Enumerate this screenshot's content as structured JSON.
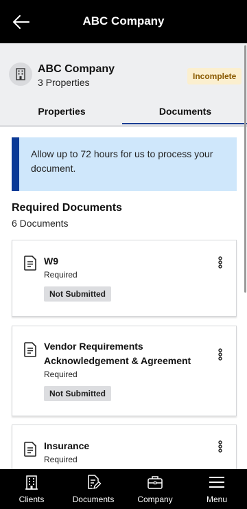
{
  "topbar": {
    "title": "ABC Company",
    "back_icon": "arrow-left-icon"
  },
  "company": {
    "name": "ABC Company",
    "properties_count": "3 Properties",
    "status_badge": "Incomplete",
    "avatar_icon": "building-icon"
  },
  "tabs": [
    {
      "label": "Properties",
      "active": false
    },
    {
      "label": "Documents",
      "active": true
    }
  ],
  "info_message": "Allow up to 72 hours for us to process your document.",
  "required_section": {
    "title": "Required Documents",
    "count": "6 Documents"
  },
  "documents": [
    {
      "title": "W9",
      "requirement": "Required",
      "status": "Not Submitted"
    },
    {
      "title": "Vendor Requirements Acknowledgement & Agreement",
      "requirement": "Required",
      "status": "Not Submitted"
    },
    {
      "title": "Insurance",
      "requirement": "Required",
      "status": ""
    }
  ],
  "bottom_nav": [
    {
      "label": "Clients",
      "icon": "building-icon"
    },
    {
      "label": "Documents",
      "icon": "document-edit-icon"
    },
    {
      "label": "Company",
      "icon": "briefcase-icon"
    },
    {
      "label": "Menu",
      "icon": "hamburger-menu-icon"
    }
  ],
  "colors": {
    "topbar": "#000000",
    "accent_blue": "#1a3d94",
    "info_background": "#cfe7fb",
    "info_bar": "#0b3a96",
    "incomplete_badge_bg": "#fbefcf",
    "incomplete_badge_text": "#8a5a00",
    "status_badge_bg": "#dcdde0"
  }
}
